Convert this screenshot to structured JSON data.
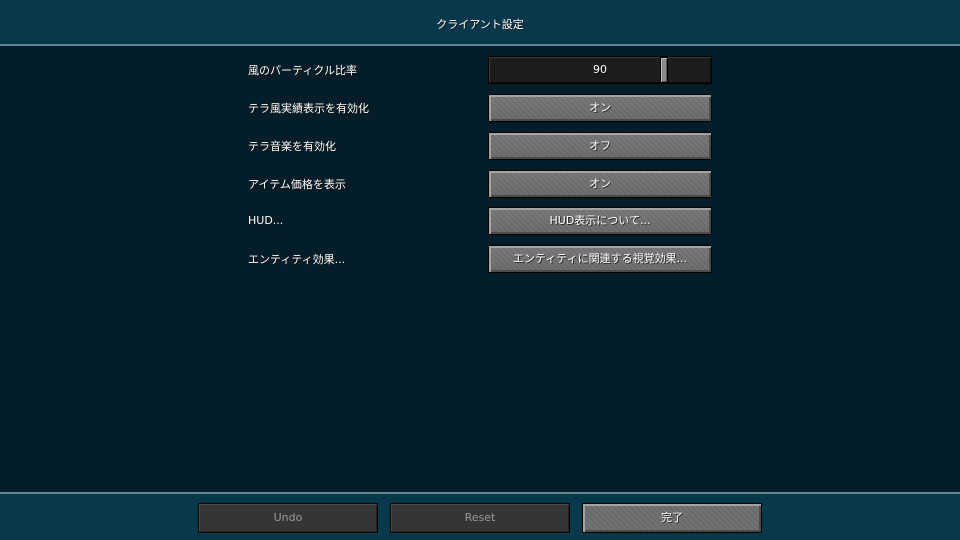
{
  "header": {
    "title": "クライアント設定"
  },
  "settings": [
    {
      "label": "風のパーティクル比率",
      "type": "slider",
      "value": "90",
      "level": 0.9
    },
    {
      "label": "テラ風実績表示を有効化",
      "type": "button",
      "value": "オン"
    },
    {
      "label": "テラ音楽を有効化",
      "type": "button",
      "value": "オフ"
    },
    {
      "label": "アイテム価格を表示",
      "type": "button",
      "value": "オン"
    },
    {
      "label": "HUD...",
      "type": "button",
      "value": "HUD表示について..."
    },
    {
      "label": "エンティティ効果...",
      "type": "button",
      "value": "エンティティに関連する視覚効果..."
    }
  ],
  "footer": {
    "undo_label": "Undo",
    "reset_label": "Reset",
    "done_label": "完了"
  },
  "colors": {
    "background": "#03202d",
    "header_bg": "#07384b",
    "header_border": "#5d8796",
    "button_face": "#737373",
    "disabled_button": "#353535"
  }
}
